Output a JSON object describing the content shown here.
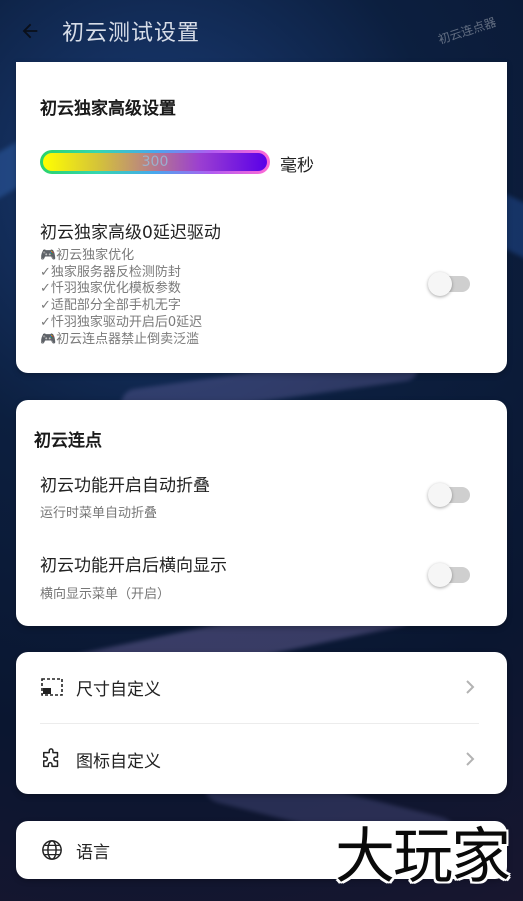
{
  "header": {
    "title": "初云测试设置",
    "watermark": "初云连点器"
  },
  "card_advanced": {
    "title": "初云独家高级设置",
    "slider": {
      "value": "300",
      "unit": "毫秒"
    },
    "driver": {
      "title": "初云独家高级0延迟驱动",
      "features": [
        "🎮初云独家优化",
        "✓独家服务器反检测防封",
        "✓忏羽独家优化模板参数",
        "✓适配部分全部手机无字",
        "✓忏羽独家驱动开启后0延迟",
        "🎮初云连点器禁止倒卖泛滥"
      ],
      "enabled": false
    }
  },
  "card_clicker": {
    "title": "初云连点",
    "rows": [
      {
        "title": "初云功能开启自动折叠",
        "subtitle": "运行时菜单自动折叠",
        "enabled": false
      },
      {
        "title": "初云功能开启后横向显示",
        "subtitle": "横向显示菜单（开启）",
        "enabled": false
      }
    ]
  },
  "card_custom": {
    "items": [
      {
        "label": "尺寸自定义",
        "icon": "resize-icon"
      },
      {
        "label": "图标自定义",
        "icon": "puzzle-icon"
      }
    ]
  },
  "card_language": {
    "label": "语言",
    "icon": "globe-icon"
  },
  "brand_watermark": "大玩家"
}
